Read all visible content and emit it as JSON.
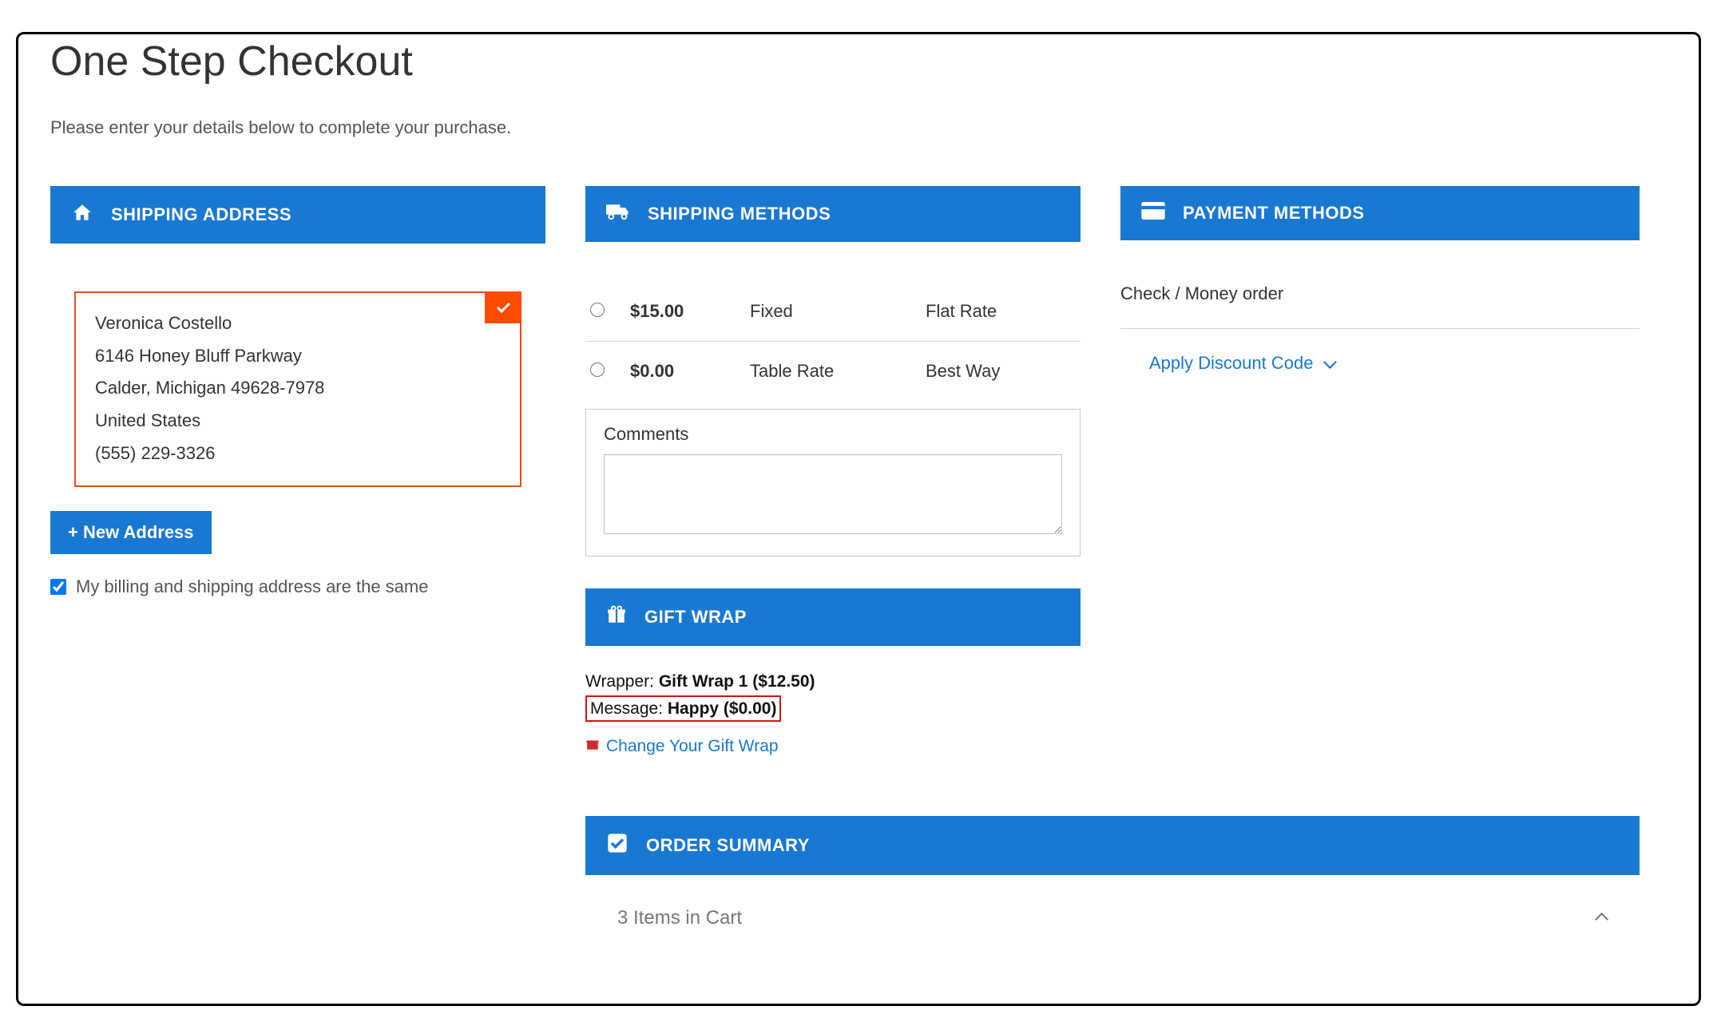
{
  "page": {
    "title": "One Step Checkout",
    "subtitle": "Please enter your details below to complete your purchase."
  },
  "shipping_address": {
    "header": "SHIPPING ADDRESS",
    "card": {
      "name": "Veronica Costello",
      "street": "6146 Honey Bluff Parkway",
      "city_line": "Calder, Michigan 49628-7978",
      "country": "United States",
      "phone": "(555) 229-3326"
    },
    "new_button": "+ New Address",
    "billing_same_label": "My billing and shipping address are the same"
  },
  "shipping_methods": {
    "header": "SHIPPING METHODS",
    "rows": [
      {
        "price": "$15.00",
        "method": "Fixed",
        "carrier": "Flat Rate"
      },
      {
        "price": "$0.00",
        "method": "Table Rate",
        "carrier": "Best Way"
      }
    ],
    "comments_label": "Comments"
  },
  "gift_wrap": {
    "header": "GIFT WRAP",
    "wrapper_label": "Wrapper: ",
    "wrapper_value": "Gift Wrap 1 ($12.50)",
    "message_label": "Message: ",
    "message_value": "Happy ($0.00)",
    "change_link": "Change Your Gift Wrap"
  },
  "order_summary": {
    "header": "ORDER SUMMARY",
    "items_in_cart": "3 Items in Cart"
  },
  "payment": {
    "header": "PAYMENT METHODS",
    "method": "Check / Money order",
    "discount_link": "Apply Discount Code"
  }
}
